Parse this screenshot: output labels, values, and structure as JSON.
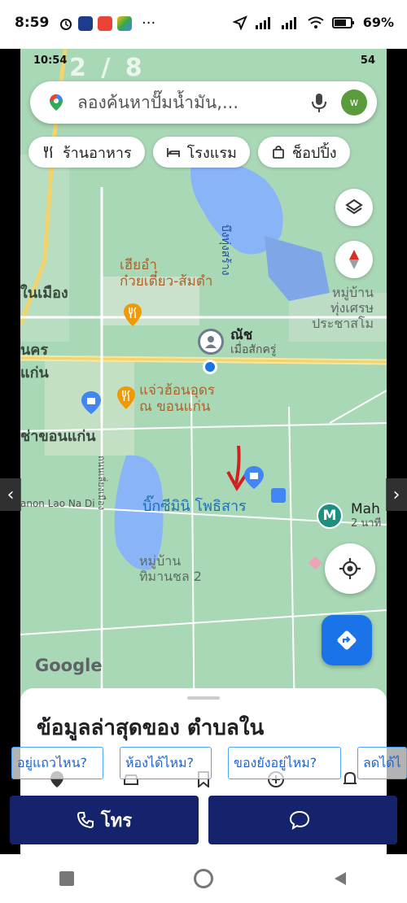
{
  "outer_status": {
    "time": "8:59",
    "battery": "69%"
  },
  "inner_status": {
    "time": "10:54",
    "battery": "54",
    "pager": "2 / 8"
  },
  "search": {
    "placeholder": "ลองค้นหาปั๊มน้ำมัน,...",
    "avatar_letter": "w"
  },
  "chips": [
    {
      "label": "ร้านอาหาร",
      "icon": "fork-knife-icon"
    },
    {
      "label": "โรงแรม",
      "icon": "bed-icon"
    },
    {
      "label": "ช็อปปิ้ง",
      "icon": "shopping-bag-icon"
    }
  ],
  "map_labels": {
    "restaurant1_line1": "เฮียอำ",
    "restaurant1_line2": "ก๋วยเตี๋ยว-ส้มตำ",
    "district": "ในเมือง",
    "left_kr": "นคร",
    "left_kan": "แก่น",
    "user_line1": "ณัช",
    "user_line2": "เมื่อสักครู่",
    "restaurant2_line1": "แจ่วฮ้อนอุดร",
    "restaurant2_line2": "ณ ขอนแก่น",
    "left_khonkaen": "ช่าขอนแก่น",
    "village_right_line1": "หมู่บ้าน",
    "village_right_line2": "ทุ่งเศรษ",
    "village_right_line3": "ประชาสโม",
    "road": "anon Lao Na Di",
    "bigc": "บิ๊กซีมินิ โพธิสาร",
    "mah": "Mah",
    "mah_sub": "2 นาที",
    "village_bottom_line1": "หมู่บ้าน",
    "village_bottom_line2": "ทิมานชล 2",
    "lake": "บึงทุ่งสร้าง",
    "road_vertical": "ถนนเลี่ยงเมือง",
    "google": "Google"
  },
  "sheet": {
    "title": "ข้อมูลล่าสุดของ ตำบลใน"
  },
  "question_chips": [
    "อยู่แถวไหน?",
    "ห้องได้ไหม?",
    "ของยังอยู่ไหม?",
    "ลดได้ไ"
  ],
  "actions": {
    "call_label": "โทร",
    "chat_label": ""
  },
  "colors": {
    "map_bg": "#a9d8b6",
    "action_bg": "#14236b",
    "directions_bg": "#1a73e8",
    "water": "#8ab4f8"
  }
}
